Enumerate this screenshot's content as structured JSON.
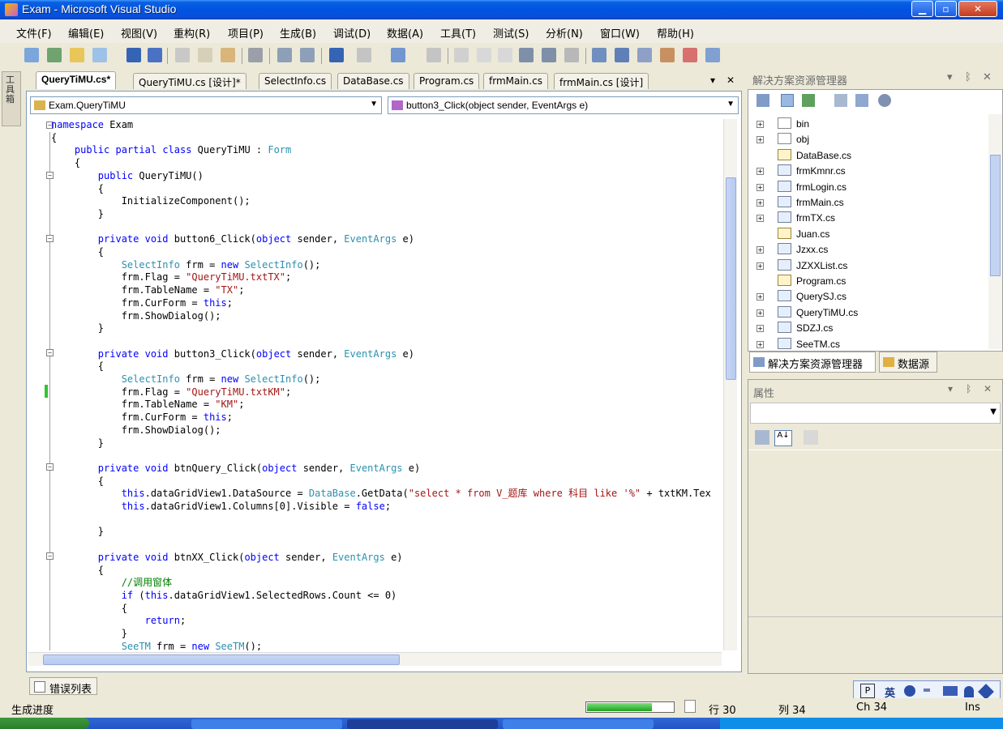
{
  "window": {
    "title": "Exam - Microsoft Visual Studio",
    "min": "▁",
    "max": "▫",
    "close": "✕"
  },
  "menu": [
    "文件(F)",
    "编辑(E)",
    "视图(V)",
    "重构(R)",
    "项目(P)",
    "生成(B)",
    "调试(D)",
    "数据(A)",
    "工具(T)",
    "测试(S)",
    "分析(N)",
    "窗口(W)",
    "帮助(H)"
  ],
  "toolbox_tab": "工具箱",
  "doc_tabs": [
    "QueryTiMU.cs*",
    "QueryTiMU.cs [设计]*",
    "SelectInfo.cs",
    "DataBase.cs",
    "Program.cs",
    "frmMain.cs",
    "frmMain.cs [设计]"
  ],
  "doc_controls": {
    "pin": "▾",
    "close": "✕"
  },
  "editor": {
    "class_combo": "Exam.QueryTiMU",
    "member_combo": "button3_Click(object sender, EventArgs e)"
  },
  "code_lines": [
    "namespace Exam",
    "{",
    "    public partial class QueryTiMU : Form",
    "    {",
    "        public QueryTiMU()",
    "        {",
    "            InitializeComponent();",
    "        }",
    "",
    "        private void button6_Click(object sender, EventArgs e)",
    "        {",
    "            SelectInfo frm = new SelectInfo();",
    "            frm.Flag = \"QueryTiMU.txtTX\";",
    "            frm.TableName = \"TX\";",
    "            frm.CurForm = this;",
    "            frm.ShowDialog();",
    "        }",
    "",
    "        private void button3_Click(object sender, EventArgs e)",
    "        {",
    "            SelectInfo frm = new SelectInfo();",
    "            frm.Flag = \"QueryTiMU.txtKM\";",
    "            frm.TableName = \"KM\";",
    "            frm.CurForm = this;",
    "            frm.ShowDialog();",
    "        }",
    "",
    "        private void btnQuery_Click(object sender, EventArgs e)",
    "        {",
    "            this.dataGridView1.DataSource = DataBase.GetData(\"select * from V_题库 where 科目 like '%\" + txtKM.Tex",
    "            this.dataGridView1.Columns[0].Visible = false;",
    "",
    "        }",
    "",
    "        private void btnXX_Click(object sender, EventArgs e)",
    "        {",
    "            //调用窗体",
    "            if (this.dataGridView1.SelectedRows.Count <= 0)",
    "            {",
    "                return;",
    "            }",
    "            SeeTM frm = new SeeTM();"
  ],
  "error_list_tab": "错误列表",
  "solution_explorer": {
    "title": "解决方案资源管理器",
    "items": [
      {
        "name": "bin",
        "type": "folder",
        "expand": "+"
      },
      {
        "name": "obj",
        "type": "folder",
        "expand": "+"
      },
      {
        "name": "DataBase.cs",
        "type": "cs",
        "expand": ""
      },
      {
        "name": "frmKmnr.cs",
        "type": "form",
        "expand": "+"
      },
      {
        "name": "frmLogin.cs",
        "type": "form",
        "expand": "+"
      },
      {
        "name": "frmMain.cs",
        "type": "form",
        "expand": "+"
      },
      {
        "name": "frmTX.cs",
        "type": "form",
        "expand": "+"
      },
      {
        "name": "Juan.cs",
        "type": "cs",
        "expand": ""
      },
      {
        "name": "Jzxx.cs",
        "type": "form",
        "expand": "+"
      },
      {
        "name": "JZXXList.cs",
        "type": "form",
        "expand": "+"
      },
      {
        "name": "Program.cs",
        "type": "cs",
        "expand": ""
      },
      {
        "name": "QuerySJ.cs",
        "type": "form",
        "expand": "+"
      },
      {
        "name": "QueryTiMU.cs",
        "type": "form",
        "expand": "+"
      },
      {
        "name": "SDZJ.cs",
        "type": "form",
        "expand": "+"
      },
      {
        "name": "SeeTM.cs",
        "type": "form",
        "expand": "+"
      }
    ],
    "tabs": [
      "解决方案资源管理器",
      "数据源"
    ]
  },
  "properties": {
    "title": "属性"
  },
  "panel_controls": {
    "dropdown": "▾",
    "pin": "ᛒ",
    "close": "✕"
  },
  "status": {
    "text": "生成进度",
    "line_label": "行 30",
    "col_label": "列 34",
    "ch_label": "Ch 34",
    "ins": "Ins",
    "progress": 0.75
  },
  "ime": {
    "mode": "英"
  },
  "colors": {
    "keyword": "#0000ff",
    "type": "#2b91af",
    "string": "#a31515",
    "comment": "#008000"
  }
}
